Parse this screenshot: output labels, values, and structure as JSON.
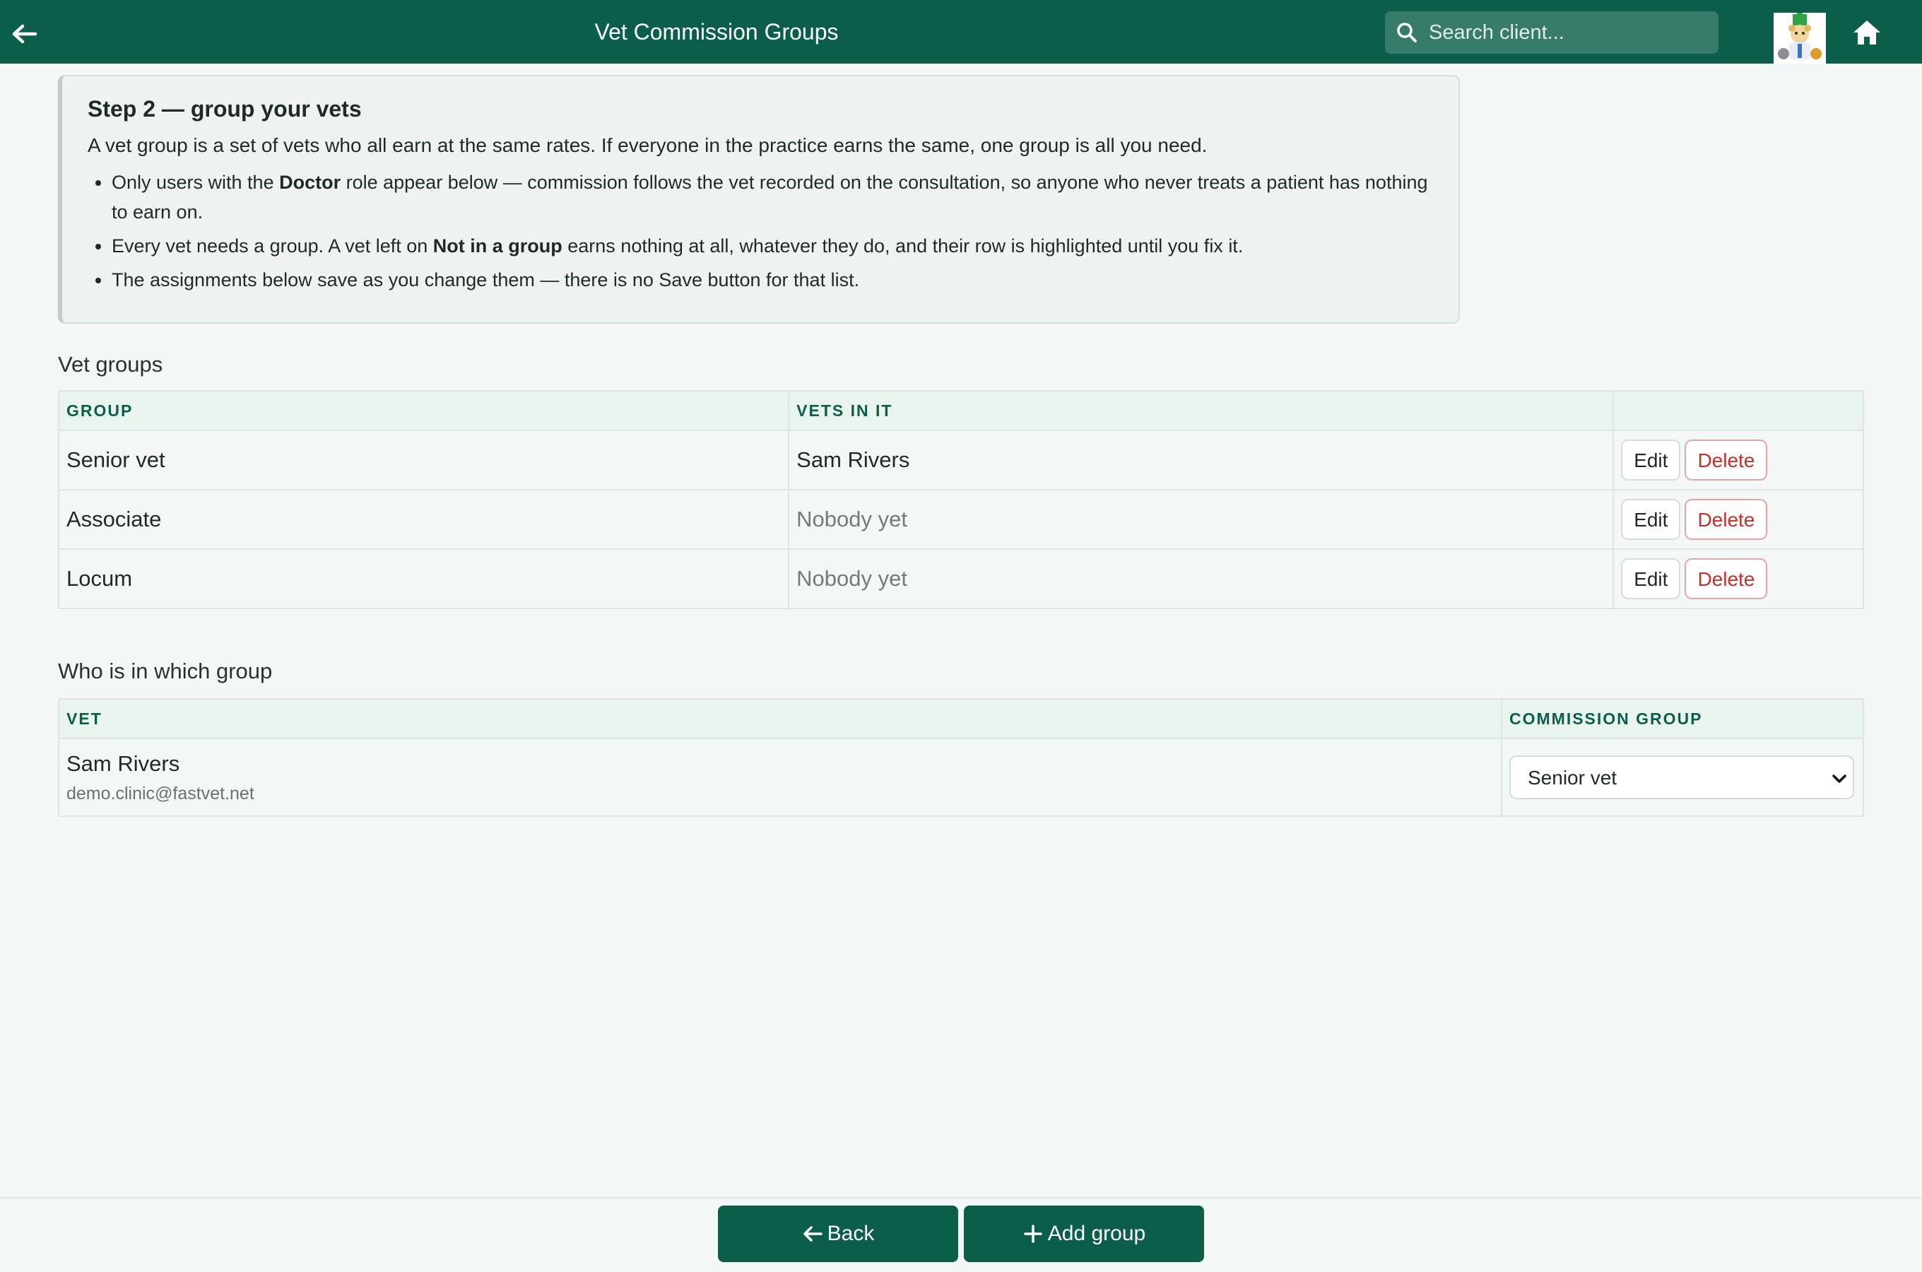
{
  "header": {
    "title": "Vet Commission Groups",
    "search_placeholder": "Search client..."
  },
  "info": {
    "heading": "Step 2 — group your vets",
    "intro": "A vet group is a set of vets who all earn at the same rates. If everyone in the practice earns the same, one group is all you need.",
    "bullet1_pre": "Only users with the ",
    "bullet1_bold": "Doctor",
    "bullet1_post": " role appear below — commission follows the vet recorded on the consultation, so anyone who never treats a patient has nothing to earn on.",
    "bullet2_pre": "Every vet needs a group. A vet left on ",
    "bullet2_bold": "Not in a group",
    "bullet2_post": " earns nothing at all, whatever they do, and their row is highlighted until you fix it.",
    "bullet3": "The assignments below save as you change them — there is no Save button for that list."
  },
  "groups": {
    "title": "Vet groups",
    "col_group": "GROUP",
    "col_vets": "VETS IN IT",
    "edit_label": "Edit",
    "delete_label": "Delete",
    "rows": [
      {
        "name": "Senior vet",
        "vets": "Sam Rivers",
        "empty": false
      },
      {
        "name": "Associate",
        "vets": "Nobody yet",
        "empty": true
      },
      {
        "name": "Locum",
        "vets": "Nobody yet",
        "empty": true
      }
    ]
  },
  "assignments": {
    "title": "Who is in which group",
    "col_vet": "VET",
    "col_group": "COMMISSION GROUP",
    "rows": [
      {
        "name": "Sam Rivers",
        "email": "demo.clinic@fastvet.net",
        "group": "Senior vet"
      }
    ]
  },
  "footer": {
    "back_label": "Back",
    "add_label": "Add group"
  },
  "colors": {
    "brand": "#0b5e4a",
    "danger": "#c0312d"
  }
}
